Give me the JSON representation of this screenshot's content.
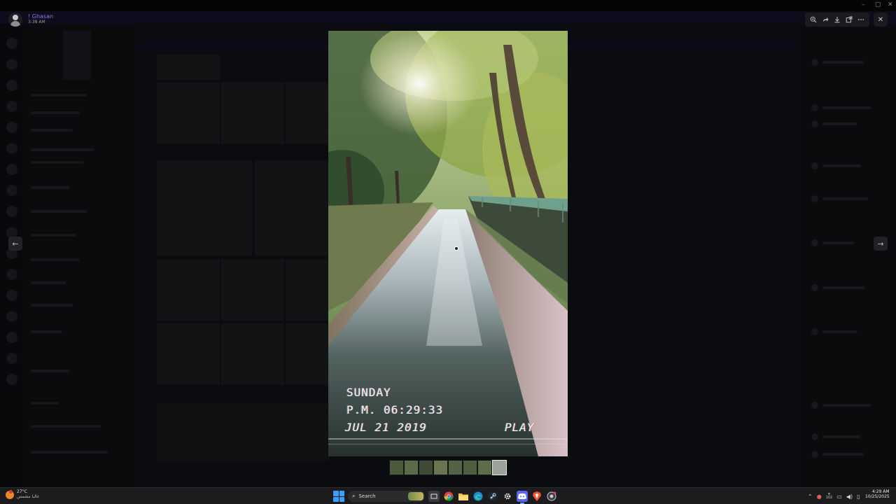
{
  "viewer": {
    "author_name": "! Ghasan",
    "author_time": "3:38 AM",
    "toolbar_icons": [
      "zoom-in-icon",
      "share-icon",
      "download-icon",
      "open-external-icon",
      "more-icon"
    ],
    "close_glyph": "✕",
    "prev_glyph": "←",
    "next_glyph": "→"
  },
  "photo": {
    "overlay_day": "SUNDAY",
    "overlay_time": "P.M. 06:29:33",
    "overlay_date": "JUL 21 2019",
    "overlay_mode": "PLAY"
  },
  "thumbnails": {
    "count": 8,
    "active_index": 7,
    "colors": [
      "#4a5b3e",
      "#5b6a48",
      "#3f4a36",
      "#6a7650",
      "#556246",
      "#4f5e3f",
      "#5e6c4a",
      "#9aa29a"
    ]
  },
  "taskbar": {
    "weather_temp": "27°C",
    "weather_desc": "غالبا مشمس",
    "search_placeholder": "Search",
    "tray_number": "102",
    "clock_time": "4:29 AM",
    "clock_date": "10/25/2025"
  },
  "colors": {
    "accent": "#8a7cf0",
    "start_blue": "#3aa0ff"
  }
}
